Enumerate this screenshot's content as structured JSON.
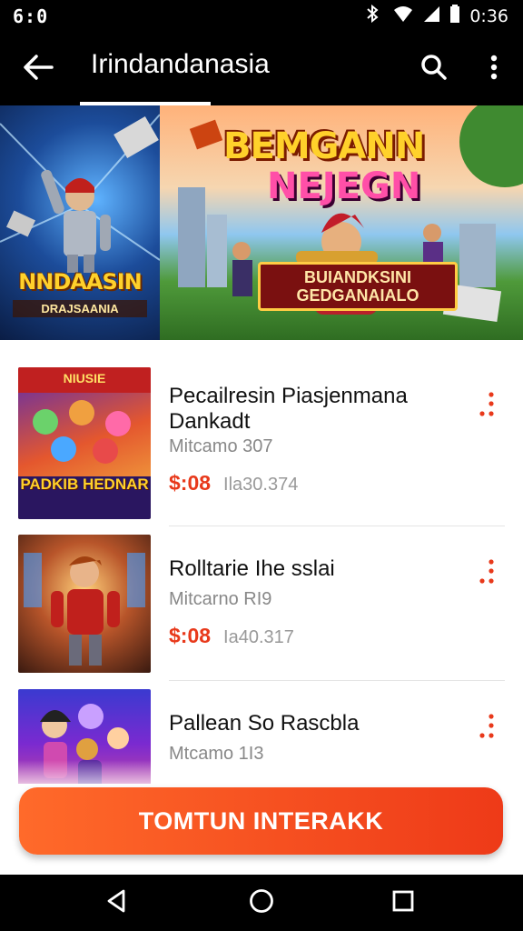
{
  "status_bar": {
    "left_text": "6:0",
    "time": "0:36"
  },
  "app_bar": {
    "title": "Irindandanasia"
  },
  "hero": {
    "left_title": "NNDAASIN",
    "left_subtitle": "DRAJSAANIA",
    "right_title_line1": "BEMGANN",
    "right_title_line2": "NEJEGN",
    "right_plaque": "BUIANDKSINI GEDGANAIALO"
  },
  "games": [
    {
      "title": "Pecailresin Piasjenmana Dankadt",
      "subtitle": "Mitcamo 307",
      "price": "$:08",
      "meta": "Ila30.374",
      "thumb_label_top": "NIUSIE",
      "thumb_label_bottom": "PADKIB HEDNAR"
    },
    {
      "title": "Rolltarie Ihe sslai",
      "subtitle": "Mitcarno RI9",
      "price": "$:08",
      "meta": "Ia40.317"
    },
    {
      "title": "Pallean So Rascbla",
      "subtitle": "Mtcamo 1I3"
    }
  ],
  "cta": {
    "label": "TOMTUN INTERAKK"
  },
  "colors": {
    "accent": "#e8391b",
    "cta_start": "#ff6a2a",
    "cta_end": "#ee3a18",
    "bar": "#000000"
  },
  "icons": {
    "back": "arrow-left-icon",
    "search": "search-icon",
    "more": "more-vert-icon",
    "nav_back": "triangle-back-icon",
    "nav_home": "circle-home-icon",
    "nav_recent": "square-recents-icon"
  }
}
